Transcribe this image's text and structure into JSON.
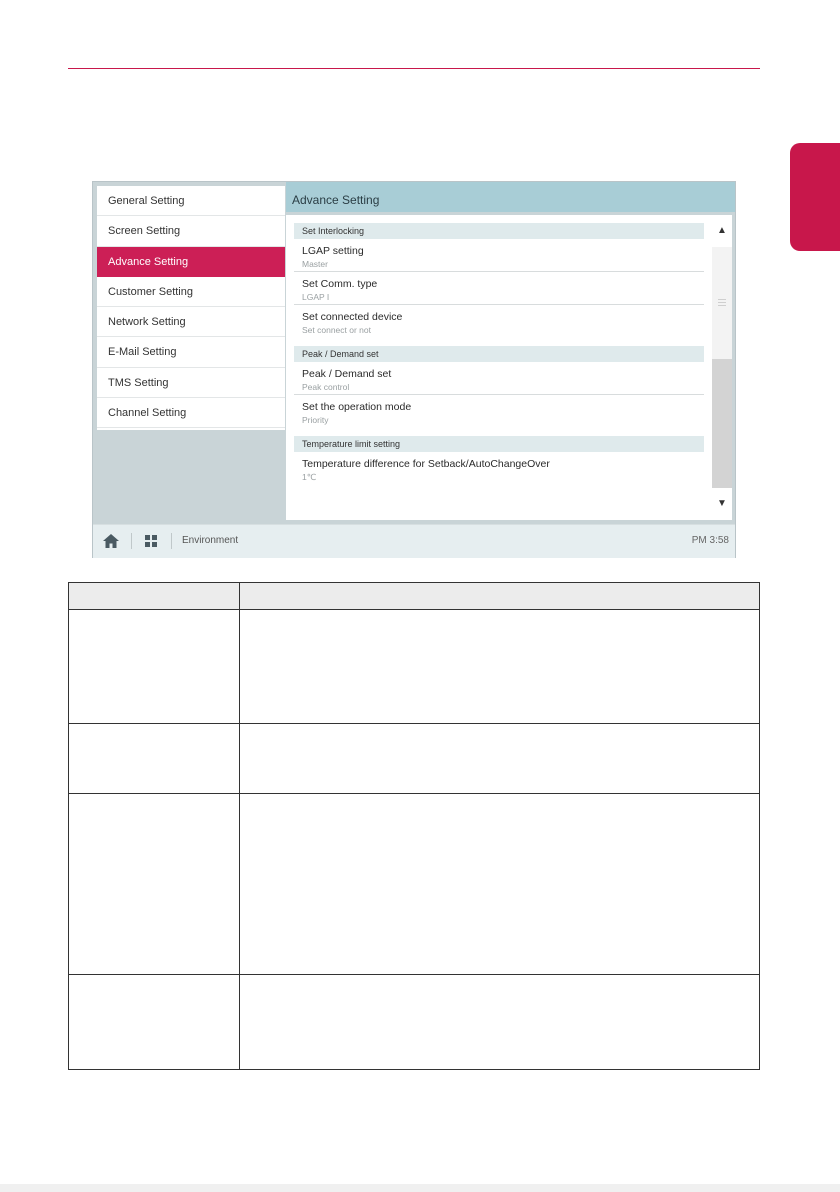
{
  "left_menu": [
    {
      "label": "General Setting",
      "active": false
    },
    {
      "label": "Screen Setting",
      "active": false
    },
    {
      "label": "Advance Setting",
      "active": true
    },
    {
      "label": "Customer Setting",
      "active": false
    },
    {
      "label": "Network Setting",
      "active": false
    },
    {
      "label": "E-Mail Setting",
      "active": false
    },
    {
      "label": "TMS Setting",
      "active": false
    },
    {
      "label": "Channel Setting",
      "active": false
    }
  ],
  "header": {
    "title": "Advance Setting"
  },
  "sections": [
    {
      "title": "Set Interlocking",
      "items": [
        {
          "title": "LGAP setting",
          "sub": "Master"
        },
        {
          "title": "Set Comm. type",
          "sub": "LGAP I"
        },
        {
          "title": "Set connected device",
          "sub": "Set connect or not"
        }
      ]
    },
    {
      "title": "Peak / Demand set",
      "items": [
        {
          "title": "Peak / Demand set",
          "sub": "Peak control"
        },
        {
          "title": "Set the operation mode",
          "sub": "Priority"
        }
      ]
    },
    {
      "title": "Temperature limit setting",
      "items": [
        {
          "title": "Temperature difference for Setback/AutoChangeOver",
          "sub": "1℃"
        }
      ]
    }
  ],
  "statusbar": {
    "breadcrumb": "Environment",
    "clock": "PM 3:58"
  },
  "colors": {
    "accent": "#c8174b",
    "panel": "#c9d4d7",
    "header": "#a8cdd6"
  }
}
